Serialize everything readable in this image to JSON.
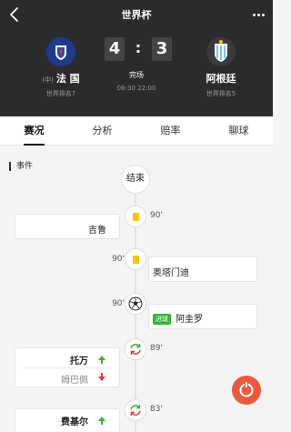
{
  "header": {
    "title": "世界杯",
    "home": {
      "tag": "(中)",
      "name": "法 国",
      "rank": "世界排名7"
    },
    "away": {
      "name": "阿根廷",
      "rank": "世界排名5"
    },
    "score_home": "4",
    "score_sep": ":",
    "score_away": "3",
    "status": "完场",
    "datetime": "06-30 22:00"
  },
  "tabs": [
    {
      "label": "赛况"
    },
    {
      "label": "分析"
    },
    {
      "label": "赔率"
    },
    {
      "label": "聊球"
    }
  ],
  "events": {
    "section_label": "事件",
    "end_label": "结束",
    "items": [
      {
        "minute": "90'",
        "side": "home",
        "icon": "yellow-card-icon",
        "player": "吉鲁"
      },
      {
        "minute": "90'",
        "side": "away",
        "icon": "yellow-card-icon",
        "player": "奥塔门迪"
      },
      {
        "minute": "90'",
        "side": "away",
        "icon": "football-icon",
        "badge": "进球",
        "player": "阿圭罗"
      },
      {
        "minute": "89'",
        "side": "home",
        "icon": "substitution-icon",
        "player_in": "托万",
        "player_out": "姆巴佩"
      },
      {
        "minute": "83'",
        "side": "home",
        "icon": "substitution-icon",
        "player_in": "费基尔"
      }
    ]
  },
  "colors": {
    "header_bg": "#2b2b2d",
    "yellow_card": "#f5c800",
    "goal_green": "#35b535",
    "sub_out_red": "#e23b3b",
    "fab": "#ec5a3e"
  }
}
